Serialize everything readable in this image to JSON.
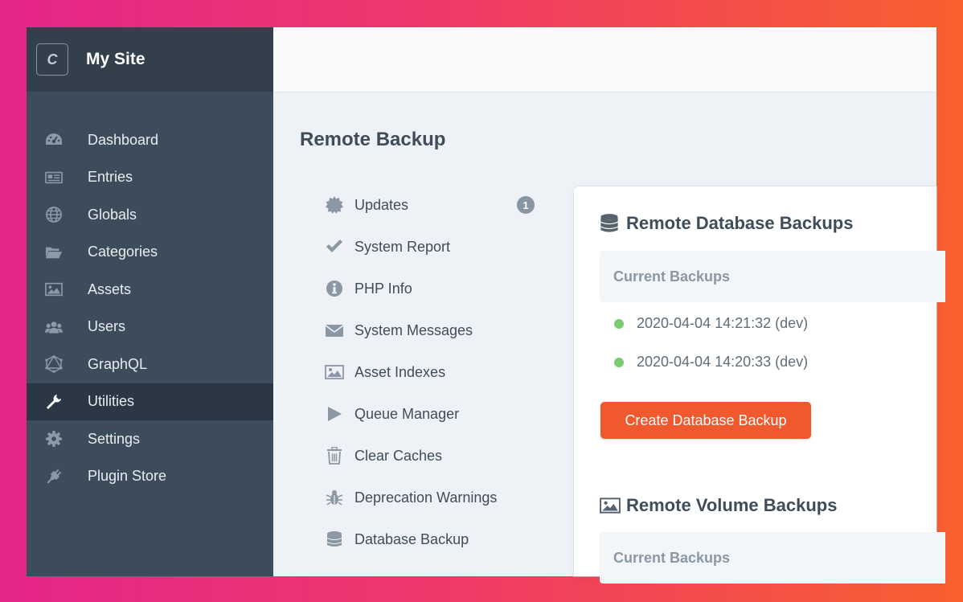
{
  "site": {
    "logo_letter": "C",
    "name": "My Site"
  },
  "sidebar": {
    "items": [
      {
        "label": "Dashboard",
        "icon": "dashboard-icon"
      },
      {
        "label": "Entries",
        "icon": "newspaper-icon"
      },
      {
        "label": "Globals",
        "icon": "globe-icon"
      },
      {
        "label": "Categories",
        "icon": "folder-open-icon"
      },
      {
        "label": "Assets",
        "icon": "image-icon"
      },
      {
        "label": "Users",
        "icon": "users-icon"
      },
      {
        "label": "GraphQL",
        "icon": "graphql-icon"
      },
      {
        "label": "Utilities",
        "icon": "wrench-icon",
        "active": true
      },
      {
        "label": "Settings",
        "icon": "gear-icon"
      },
      {
        "label": "Plugin Store",
        "icon": "plug-icon"
      }
    ]
  },
  "main": {
    "title": "Remote Backup",
    "utilities": [
      {
        "label": "Updates",
        "icon": "cog-burst-icon",
        "badge": "1"
      },
      {
        "label": "System Report",
        "icon": "check-icon"
      },
      {
        "label": "PHP Info",
        "icon": "info-icon"
      },
      {
        "label": "System Messages",
        "icon": "envelope-icon"
      },
      {
        "label": "Asset Indexes",
        "icon": "image-icon"
      },
      {
        "label": "Queue Manager",
        "icon": "play-icon"
      },
      {
        "label": "Clear Caches",
        "icon": "trash-icon"
      },
      {
        "label": "Deprecation Warnings",
        "icon": "bug-icon"
      },
      {
        "label": "Database Backup",
        "icon": "database-icon"
      }
    ]
  },
  "db_section": {
    "title": "Remote Database Backups",
    "current_label": "Current Backups",
    "backups": [
      {
        "label": "2020-04-04 14:21:32 (dev)",
        "status_color": "#7acb72"
      },
      {
        "label": "2020-04-04 14:20:33 (dev)",
        "status_color": "#7acb72"
      }
    ],
    "create_button": "Create Database Backup"
  },
  "volume_section": {
    "title": "Remote Volume Backups",
    "current_label": "Current Backups"
  },
  "colors": {
    "sidebar_bg": "#3d4c5a",
    "sidebar_active": "#2b3744",
    "accent_button": "#f0582e",
    "status_ok": "#7acb72"
  }
}
